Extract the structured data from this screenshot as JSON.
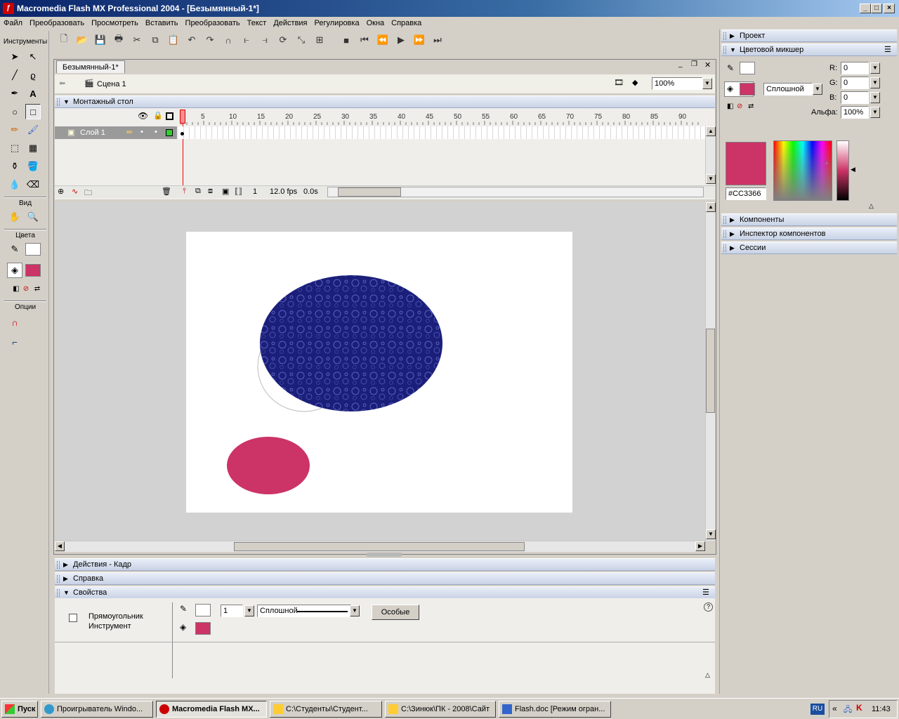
{
  "window": {
    "title": "Macromedia Flash MX Professional 2004 - [Безымянный-1*]"
  },
  "menu": [
    "Файл",
    "Преобразовать",
    "Просмотреть",
    "Вставить",
    "Преобразовать",
    "Текст",
    "Действия",
    "Регулировка",
    "Окна",
    "Справка"
  ],
  "tools": {
    "header": "Инструменты",
    "view_label": "Вид",
    "colors_label": "Цвета",
    "options_label": "Опции"
  },
  "document": {
    "tab": "Безымянный-1*",
    "scene": "Сцена 1",
    "zoom": "100%"
  },
  "timeline": {
    "title": "Монтажный стол",
    "ruler": [
      "1",
      "5",
      "10",
      "15",
      "20",
      "25",
      "30",
      "35",
      "40",
      "45",
      "50",
      "55",
      "60",
      "65",
      "70",
      "75",
      "80",
      "85",
      "90"
    ],
    "layer": "Слой 1",
    "frame": "1",
    "fps": "12.0 fps",
    "time": "0.0s"
  },
  "stage": {
    "fill_color": "#CC3366",
    "ellipse_color": "#1a1f7a"
  },
  "panels": {
    "actions": "Действия - Кадр",
    "help": "Справка",
    "properties": "Свойства"
  },
  "properties": {
    "tool_line1": "Прямоугольник",
    "tool_line2": "Инструмент",
    "stroke_size": "1",
    "stroke_style": "Сплошной",
    "custom_button": "Особые"
  },
  "right": {
    "project": "Проект",
    "mixer": "Цветовой микшер",
    "fill_type": "Сплошной",
    "r_label": "R:",
    "g_label": "G:",
    "b_label": "B:",
    "alpha_label": "Альфа:",
    "r": "0",
    "g": "0",
    "b": "0",
    "alpha": "100%",
    "hex": "#CC3366",
    "components": "Компоненты",
    "component_inspector": "Инспектор компонентов",
    "sessions": "Сессии"
  },
  "taskbar": {
    "start": "Пуск",
    "tasks": [
      "Проигрыватель Windo...",
      "Macromedia Flash MX...",
      "C:\\Студенты\\Студент...",
      "C:\\Зинюк\\ПК - 2008\\Сайт",
      "Flash.doc [Режим огран..."
    ],
    "lang": "RU",
    "clock": "11:43"
  }
}
